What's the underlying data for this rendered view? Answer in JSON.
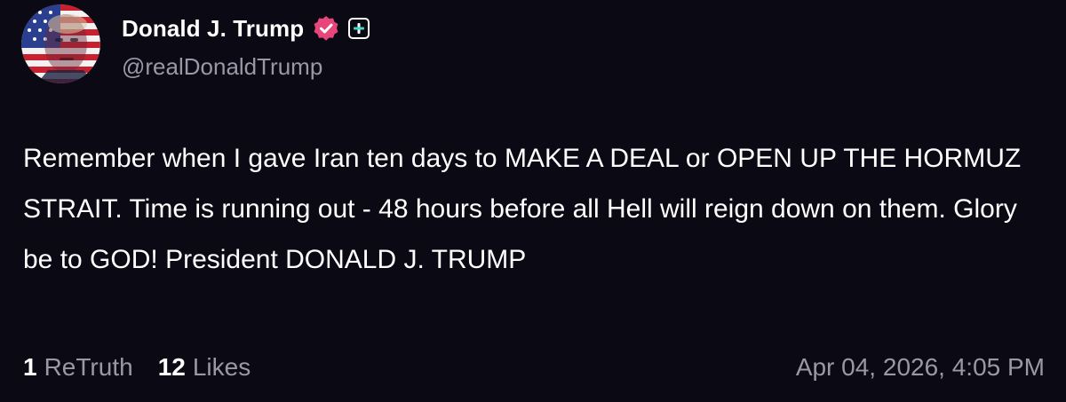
{
  "post": {
    "author": {
      "display_name": "Donald J. Trump",
      "handle": "@realDonaldTrump",
      "verified": true,
      "avatar_icon": "flag-portrait-avatar"
    },
    "badges": {
      "verified_icon": "verified-badge-icon",
      "verified_color": "#e8457a",
      "plus_icon": "plus-badge-icon",
      "plus_accent": "#3fd9c5"
    },
    "body_text": "Remember when I gave Iran ten days to MAKE A DEAL or OPEN UP THE HORMUZ STRAIT. Time is running out - 48 hours before all Hell will reign down on them. Glory be to GOD! President DONALD J. TRUMP",
    "stats": {
      "retruth_count": "1",
      "retruth_label": "ReTruth",
      "likes_count": "12",
      "likes_label": "Likes"
    },
    "timestamp": "Apr 04, 2026, 4:05 PM"
  },
  "colors": {
    "background": "#0b0914",
    "primary_text": "#ffffff",
    "secondary_text": "#9a98a6"
  }
}
